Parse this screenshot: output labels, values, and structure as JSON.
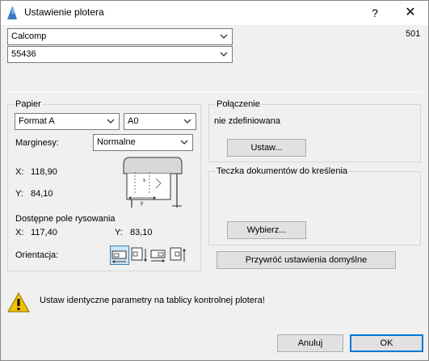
{
  "window": {
    "title": "Ustawienie plotera",
    "help_label": "?",
    "close_label": "✕"
  },
  "plotter": {
    "model": "Calcomp",
    "variant": "55436",
    "number": "501"
  },
  "paper": {
    "group_title": "Papier",
    "format": "Format A",
    "size": "A0",
    "margins_label": "Marginesy:",
    "margins_value": "Normalne",
    "x_label": "X:",
    "x_value": "118,90",
    "y_label": "Y:",
    "y_value": "84,10",
    "area_title": "Dostępne pole rysowania",
    "area_x_label": "X:",
    "area_x_value": "117,40",
    "area_y_label": "Y:",
    "area_y_value": "83,10",
    "orientation_label": "Orientacja:"
  },
  "connection": {
    "group_title": "Połączenie",
    "status": "nie zdefiniowana",
    "set_button": "Ustaw..."
  },
  "folder": {
    "group_title": "Teczka dokumentów do kreślenia",
    "choose_button": "Wybierz..."
  },
  "restore_button": "Przywróć ustawienia domyślne",
  "warning": {
    "text": "Ustaw identyczne parametry na tablicy kontrolnej plotera!",
    "icon": "warning-icon"
  },
  "footer": {
    "cancel_label": "Anuluj",
    "ok_label": "OK"
  },
  "colors": {
    "accent": "#0078d7",
    "selection": "#cce4f7",
    "warning": "#f2c200"
  }
}
